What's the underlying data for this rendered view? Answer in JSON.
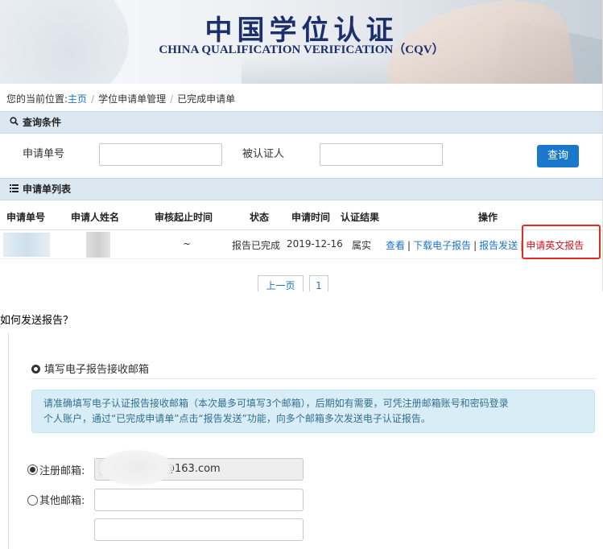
{
  "banner": {
    "title_cn": "中国学位认证",
    "title_en": "CHINA QUALIFICATION VERIFICATION（CQV）"
  },
  "breadcrumb": {
    "prefix": "您的当前位置:",
    "home": "主页",
    "sep": "/",
    "item2": "学位申请单管理",
    "item3": "已完成申请单"
  },
  "query": {
    "section_title": "查询条件",
    "app_no_label": "申请单号",
    "app_no_value": "",
    "verified_person_label": "被认证人",
    "verified_person_value": "",
    "button": "查询"
  },
  "list": {
    "section_title": "申请单列表",
    "columns": [
      "申请单号",
      "申请人姓名",
      "审核起止时间",
      "状态",
      "申请时间",
      "认证结果",
      "操作"
    ],
    "row": {
      "period": "~",
      "status": "报告已完成",
      "date": "2019-12-16",
      "result": "属实",
      "ops": [
        "查看",
        "下载电子报告",
        "报告发送",
        "申请英文报告"
      ],
      "op_sep": "|"
    }
  },
  "pager": {
    "prev": "上一页",
    "page": "1"
  },
  "question": "如何发送报告？",
  "form": {
    "section_title": "填写电子报告接收邮箱",
    "notice_line1": "请准确填写电子认证报告接收邮箱（本次最多可填写3个邮箱），后期如有需要，可凭注册邮箱账号和密码登录",
    "notice_line2": "个人账户，通过“已完成申请单”点击“报告发送”功能，向多个邮箱多次发送电子认证报告。",
    "registered_label": "注册邮箱:",
    "registered_value_suffix": "@163.com",
    "other_label": "其他邮箱:",
    "other_value_1": "",
    "other_value_2": ""
  },
  "colors": {
    "accent": "#1977cc",
    "link": "#1c73c9",
    "highlight": "#e42b22",
    "header_bg": "#dbe7f1",
    "notice_bg": "#d9edf7"
  }
}
